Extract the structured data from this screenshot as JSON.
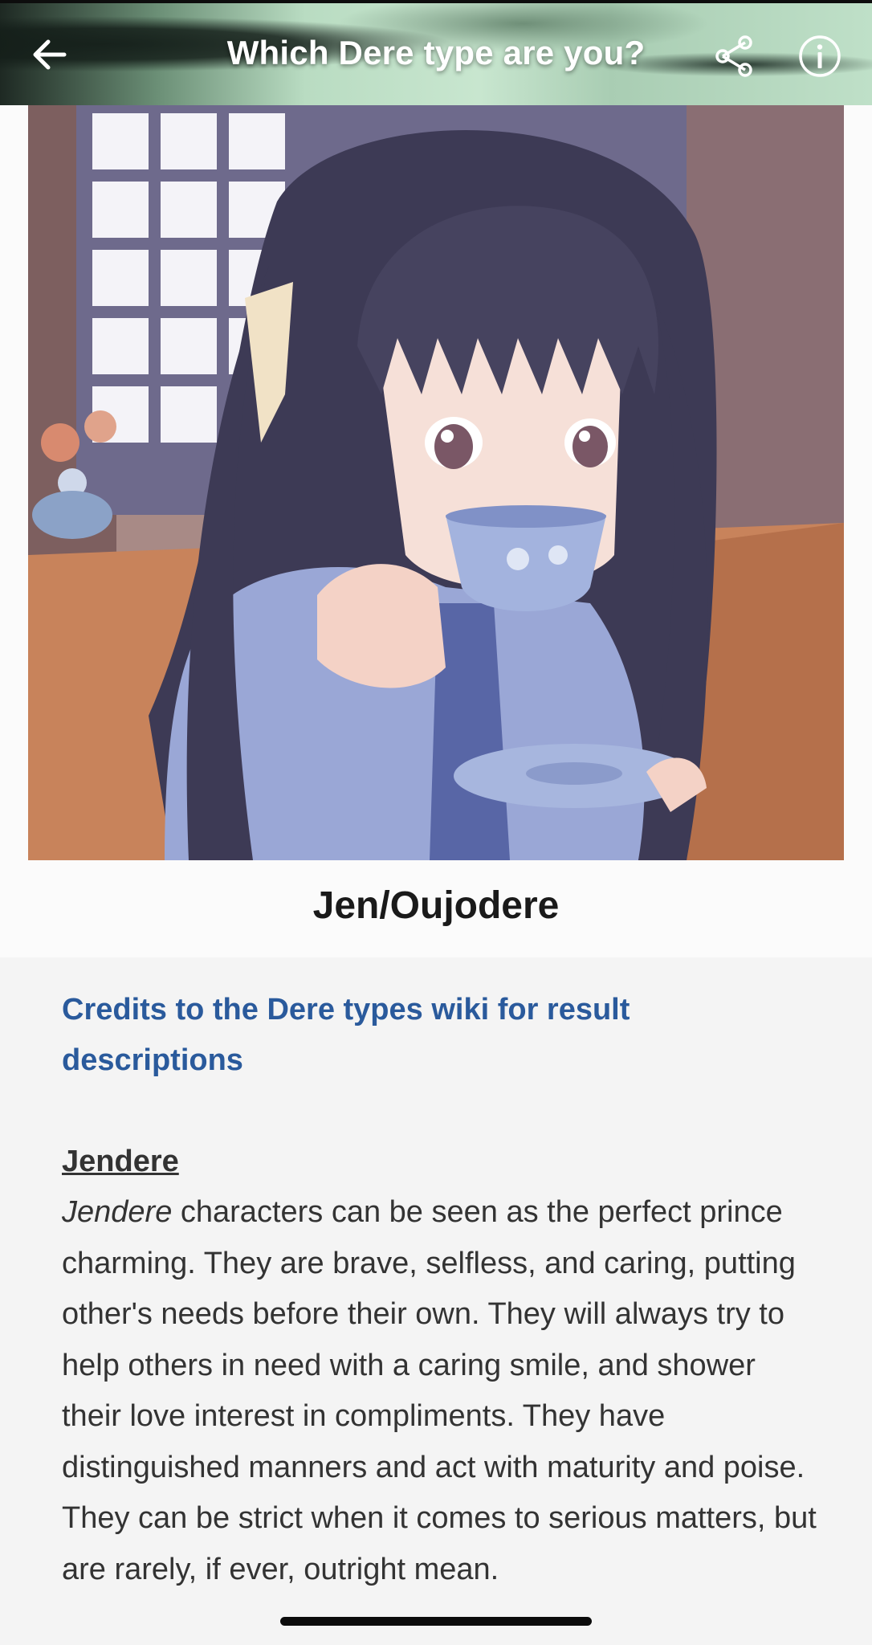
{
  "topbar": {
    "back_icon": "arrow-left-icon",
    "title": "Which Dere type are you?",
    "share_icon": "share-icon",
    "info_icon": "info-circle-icon"
  },
  "result": {
    "image_alt": "anime-girl-drinking-tea",
    "title": "Jen/Oujodere"
  },
  "description": {
    "credits": "Credits to the Dere types wiki for result descriptions",
    "heading": "Jendere",
    "body_italic_term": "Jendere",
    "body_rest": " characters can be seen as the perfect prince charming. They are brave, selfless, and caring, putting other's needs before their own. They will always try to help others in need with a caring smile, and shower their love interest in compliments. They have distinguished manners and act with maturity and poise. They can be strict when it comes to serious matters, but are rarely, if ever, outright mean."
  },
  "colors": {
    "link_blue": "#2a5a9c",
    "text_dark": "#333333",
    "background": "#f4f4f4"
  }
}
